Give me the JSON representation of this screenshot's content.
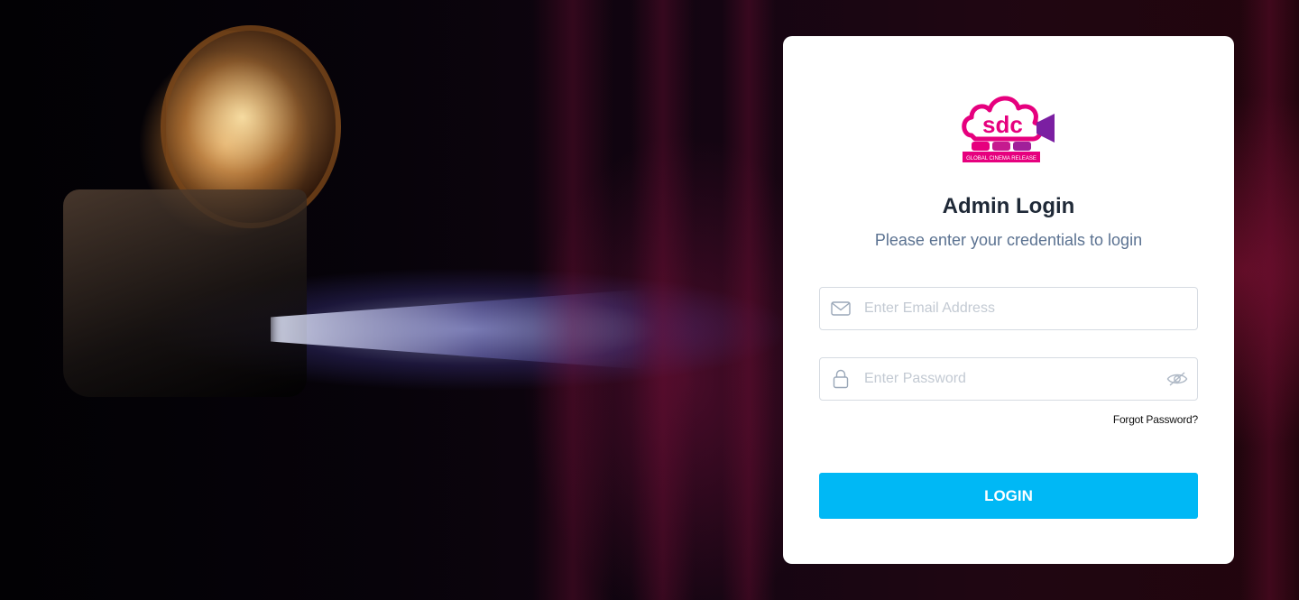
{
  "brand": {
    "logo_text": "sdc",
    "logo_tagline": "GLOBAL CINEMA RELEASE",
    "colors": {
      "magenta": "#e6007e",
      "purple": "#7b1fa2"
    }
  },
  "login": {
    "title": "Admin Login",
    "subtitle": "Please enter your credentials to login",
    "email": {
      "placeholder": "Enter Email Address",
      "value": "",
      "icon": "envelope-icon"
    },
    "password": {
      "placeholder": "Enter Password",
      "value": "",
      "icon": "lock-icon",
      "toggle_icon": "eye-slash-icon"
    },
    "forgot_label": "Forgot Password?",
    "submit_label": "LOGIN",
    "accent_color": "#00b8f5"
  }
}
